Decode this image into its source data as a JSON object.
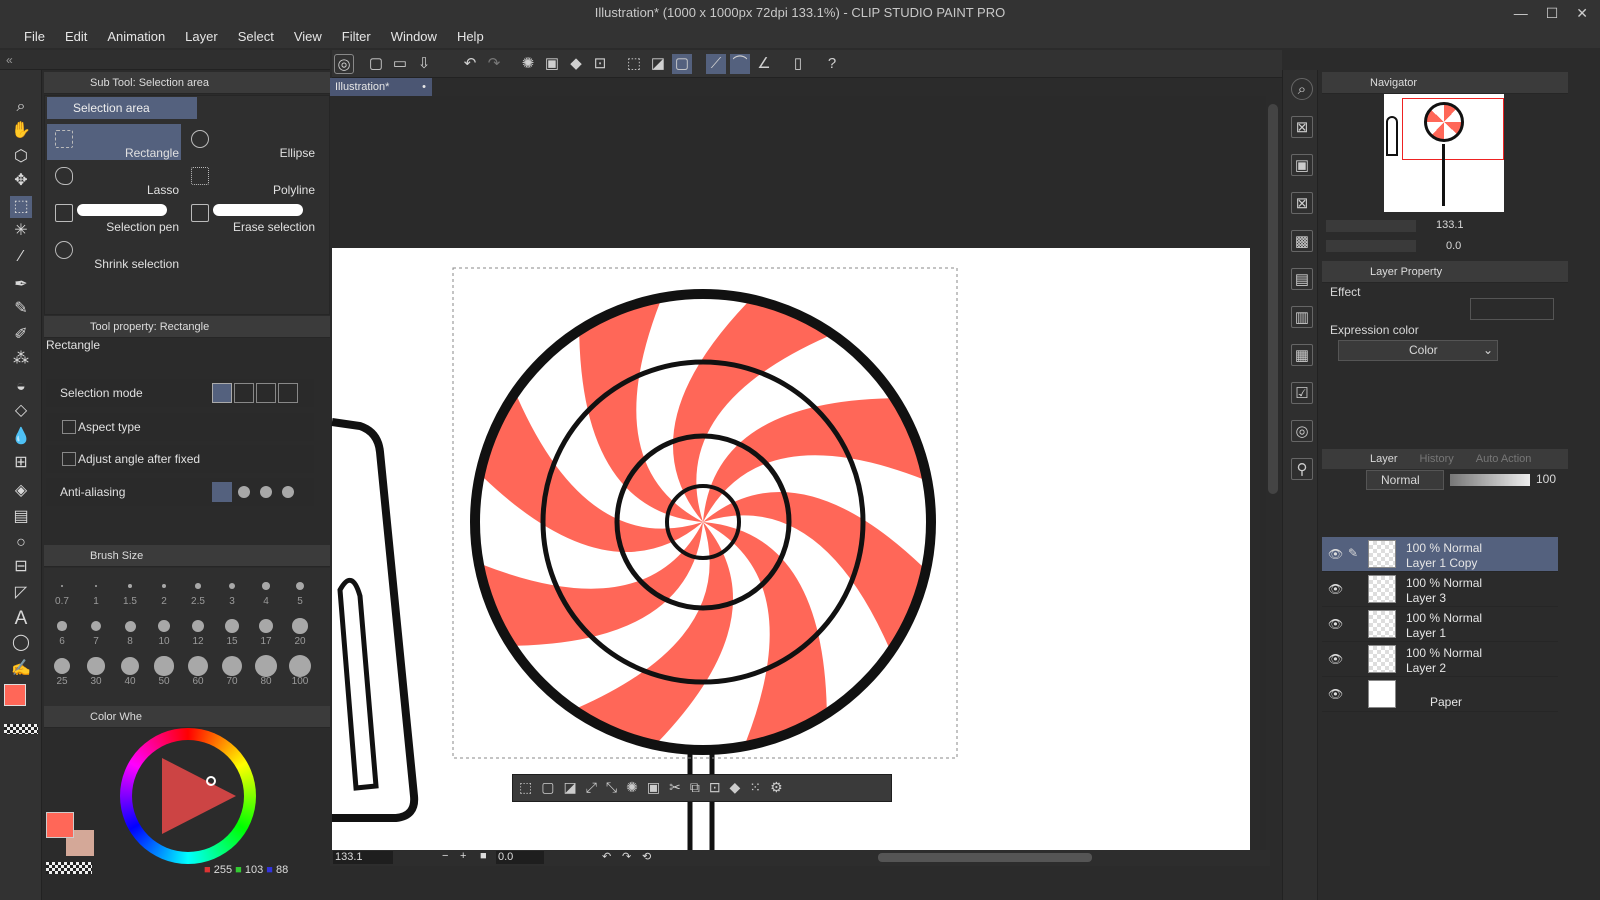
{
  "window": {
    "title": "Illustration* (1000 x 1000px 72dpi 133.1%) - CLIP STUDIO PAINT PRO",
    "min": "—",
    "max": "☐",
    "close": "✕"
  },
  "menu": [
    "File",
    "Edit",
    "Animation",
    "Layer",
    "Select",
    "View",
    "Filter",
    "Window",
    "Help"
  ],
  "subtool": {
    "header": "Sub Tool: Selection area",
    "group": "Selection area",
    "items": [
      "Rectangle",
      "Ellipse",
      "Lasso",
      "Polyline",
      "Selection pen",
      "Erase selection",
      "Shrink selection"
    ]
  },
  "toolprop": {
    "header": "Tool property: Rectangle",
    "name": "Rectangle",
    "selection_mode": "Selection mode",
    "aspect_type": "Aspect type",
    "adjust_angle": "Adjust angle after fixed",
    "anti_aliasing": "Anti-aliasing"
  },
  "brushsize": {
    "header": "Brush Size",
    "sizes": [
      "0.7",
      "1",
      "1.5",
      "2",
      "2.5",
      "3",
      "4",
      "5",
      "6",
      "7",
      "8",
      "10",
      "12",
      "15",
      "17",
      "20",
      "25",
      "30",
      "40",
      "50",
      "60",
      "70",
      "80",
      "100"
    ]
  },
  "colorwheel": {
    "header": "Color Whe",
    "r": "255",
    "g": "103",
    "b": "88",
    "main_color": "#ff6758",
    "sub_color": "#d4a898"
  },
  "document": {
    "tab": "Illustration*",
    "zoom": "133.1",
    "rotation": "0.0"
  },
  "navigator": {
    "header": "Navigator",
    "zoom": "133.1",
    "rotation": "0.0"
  },
  "layerprop": {
    "header": "Layer Property",
    "effect": "Effect",
    "expr_label": "Expression color",
    "expr_value": "Color"
  },
  "layerpanel": {
    "tabs": [
      "Layer",
      "History",
      "Auto Action"
    ],
    "blend": "Normal",
    "opacity": "100",
    "layers": [
      {
        "mode": "100 % Normal",
        "name": "Layer 1 Copy"
      },
      {
        "mode": "100 % Normal",
        "name": "Layer 3"
      },
      {
        "mode": "100 % Normal",
        "name": "Layer 1"
      },
      {
        "mode": "100 % Normal",
        "name": "Layer 2"
      },
      {
        "mode": "",
        "name": "Paper"
      }
    ]
  },
  "colors": {
    "accent": "#54617e",
    "candy": "#ff6758"
  }
}
